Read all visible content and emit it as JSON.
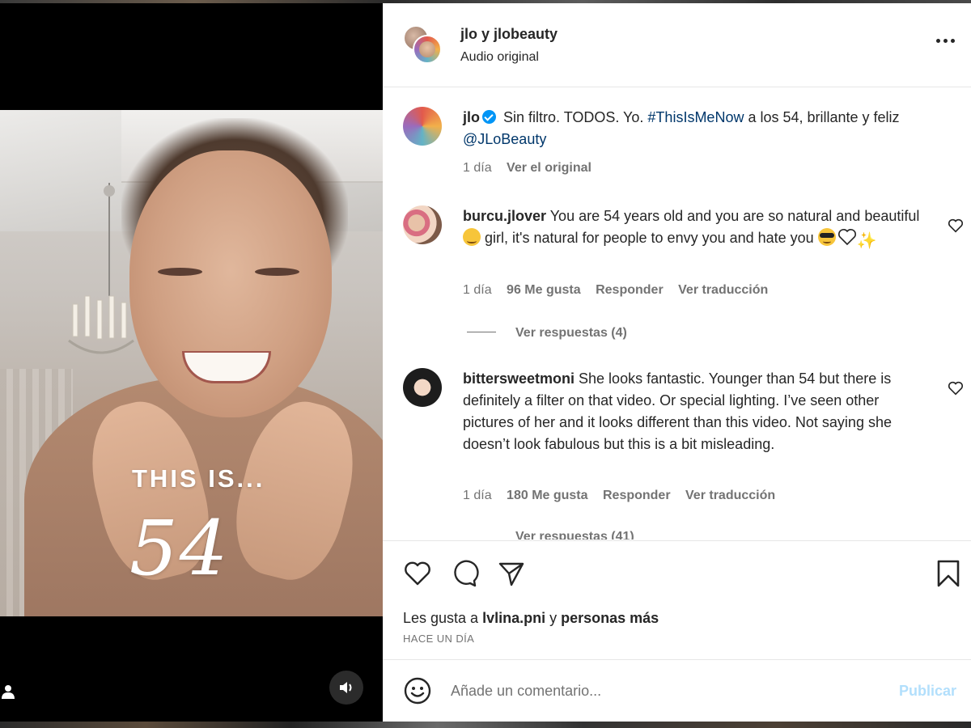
{
  "media": {
    "overlay_line1": "THIS IS...",
    "overlay_line2": "54"
  },
  "post_header": {
    "title": "jlo y jlobeauty",
    "subtitle": "Audio original"
  },
  "caption": {
    "username": "jlo",
    "text_before_tag": " Sin filtro. TODOS. Yo. ",
    "hashtag": "#ThisIsMeNow",
    "text_after_tag": " a los 54, brillante y feliz ",
    "mention": "@JLoBeauty",
    "time": "1 día",
    "see_original": "Ver el original"
  },
  "comments": [
    {
      "username": "burcu.jlover",
      "text_a": " You are 54 years old and you are so natural and beautiful ",
      "text_b": " girl, it's natural for people to envy you and hate you ",
      "emojis": [
        "smirking-face-emoji",
        "smiling-face-with-sunglasses-emoji",
        "white-heart-emoji",
        "sparkles-emoji"
      ],
      "time": "1 día",
      "likes": "96 Me gusta",
      "reply": "Responder",
      "translate": "Ver traducción",
      "replies": "Ver respuestas (4)"
    },
    {
      "username": "bittersweetmoni",
      "text": " She looks fantastic. Younger than 54 but there is definitely a filter on that video. Or special lighting. I’ve seen other pictures of her and it looks different than this video. Not saying she doesn’t look fabulous but this is a bit misleading.",
      "time": "1 día",
      "likes": "180 Me gusta",
      "reply": "Responder",
      "translate": "Ver traducción",
      "replies": "Ver respuestas (41)"
    }
  ],
  "likes_summary": {
    "prefix": "Les gusta a ",
    "user": "lvlina.pni",
    "middle": " y ",
    "others": "personas más"
  },
  "timestamp": "HACE UN DÍA",
  "composer": {
    "placeholder": "Añade un comentario...",
    "publish_label": "Publicar"
  },
  "colors": {
    "link": "#00376b",
    "verified": "#0095f6",
    "publish_disabled": "#b2dffc",
    "muted_text": "#737373"
  }
}
